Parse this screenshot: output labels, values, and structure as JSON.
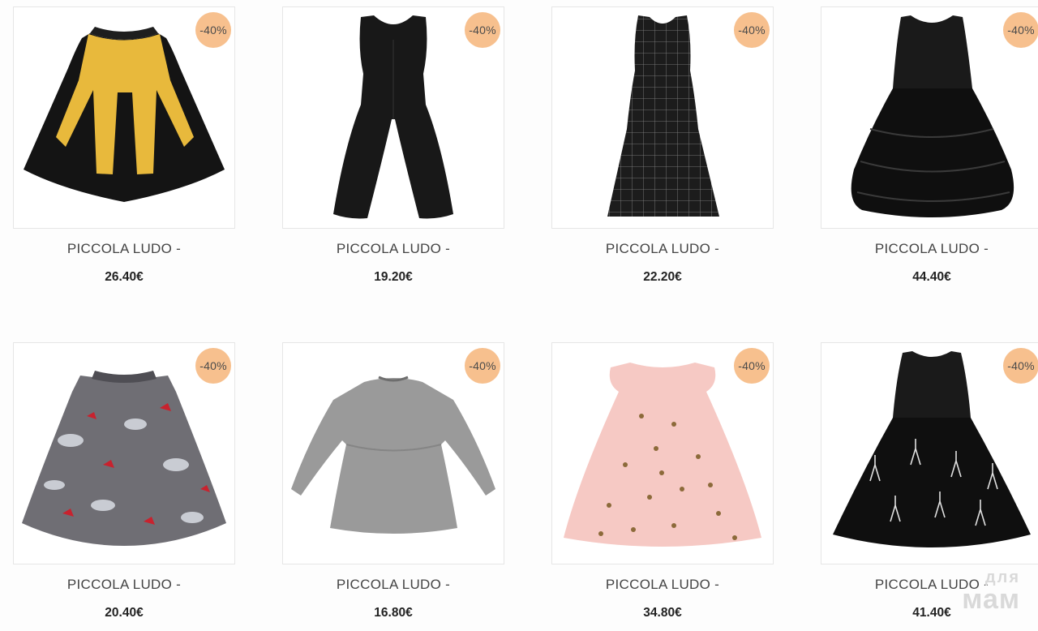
{
  "products": [
    {
      "brand": "PICCOLA LUDO -",
      "price": "26.40€",
      "discount": "-40%",
      "image": "black-yellow-sleeveless-dress"
    },
    {
      "brand": "PICCOLA LUDO -",
      "price": "19.20€",
      "discount": "-40%",
      "image": "black-wide-leg-jumpsuit"
    },
    {
      "brand": "PICCOLA LUDO -",
      "price": "22.20€",
      "discount": "-40%",
      "image": "black-check-jumpsuit"
    },
    {
      "brand": "PICCOLA LUDO -",
      "price": "44.40€",
      "discount": "-40%",
      "image": "black-tulle-party-dress"
    },
    {
      "brand": "PICCOLA LUDO -",
      "price": "20.40€",
      "discount": "-40%",
      "image": "grey-umbrella-print-dress"
    },
    {
      "brand": "PICCOLA LUDO -",
      "price": "16.80€",
      "discount": "-40%",
      "image": "grey-long-sleeve-dress"
    },
    {
      "brand": "PICCOLA LUDO -",
      "price": "34.80€",
      "discount": "-40%",
      "image": "pink-star-tulle-dress"
    },
    {
      "brand": "PICCOLA LUDO -",
      "price": "41.40€",
      "discount": "-40%",
      "image": "black-ballerina-tulle-dress"
    }
  ],
  "watermark": {
    "top": "для",
    "bottom": "мам"
  },
  "colors": {
    "badge": "#f7c08e",
    "frame_border": "#e6e6e6",
    "yellow": "#e8b93c",
    "pink": "#f6c9c4"
  }
}
